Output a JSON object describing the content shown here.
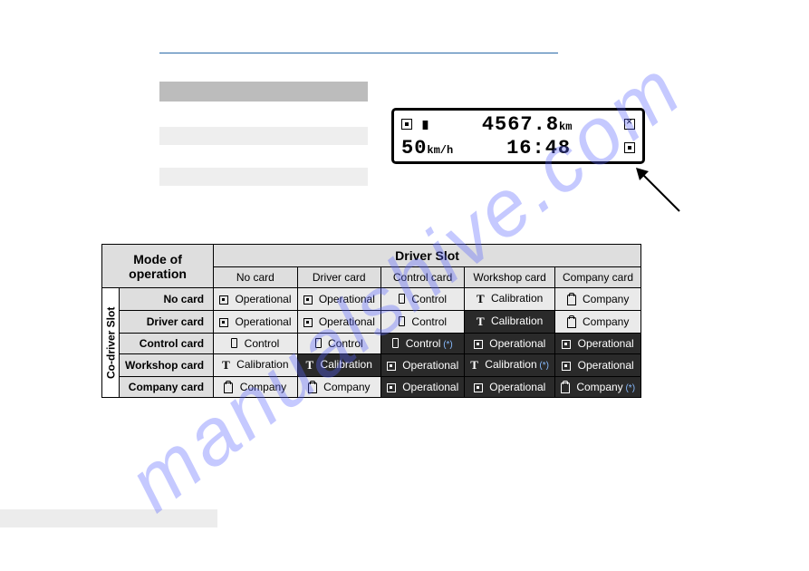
{
  "lcd": {
    "distance_value": "4567.8",
    "distance_unit": "km",
    "speed_value": "50",
    "speed_unit": "km/h",
    "time": "16:48"
  },
  "table": {
    "corner_line1": "Mode of",
    "corner_line2": "operation",
    "side_label": "Co-driver Slot",
    "top_label": "Driver Slot",
    "cols": [
      "No card",
      "Driver card",
      "Control card",
      "Workshop card",
      "Company card"
    ],
    "rows": [
      "No card",
      "Driver card",
      "Control card",
      "Workshop card",
      "Company card"
    ],
    "cells": [
      [
        {
          "icon": "dot",
          "text": "Operational",
          "dark": false
        },
        {
          "icon": "dot",
          "text": "Operational",
          "dark": false
        },
        {
          "icon": "phone",
          "text": "Control",
          "dark": false
        },
        {
          "icon": "t",
          "text": "Calibration",
          "dark": false
        },
        {
          "icon": "clip",
          "text": "Company",
          "dark": false
        }
      ],
      [
        {
          "icon": "dot",
          "text": "Operational",
          "dark": false
        },
        {
          "icon": "dot",
          "text": "Operational",
          "dark": false
        },
        {
          "icon": "phone",
          "text": "Control",
          "dark": false
        },
        {
          "icon": "t",
          "text": "Calibration",
          "dark": true
        },
        {
          "icon": "clip",
          "text": "Company",
          "dark": false
        }
      ],
      [
        {
          "icon": "phone",
          "text": "Control",
          "dark": false
        },
        {
          "icon": "phone",
          "text": "Control",
          "dark": false
        },
        {
          "icon": "phone",
          "text": "Control",
          "dark": true,
          "star": true
        },
        {
          "icon": "dot",
          "text": "Operational",
          "dark": true
        },
        {
          "icon": "dot",
          "text": "Operational",
          "dark": true
        }
      ],
      [
        {
          "icon": "t",
          "text": "Calibration",
          "dark": false
        },
        {
          "icon": "t",
          "text": "Calibration",
          "dark": true
        },
        {
          "icon": "dot",
          "text": "Operational",
          "dark": true
        },
        {
          "icon": "t",
          "text": "Calibration",
          "dark": true,
          "star": true
        },
        {
          "icon": "dot",
          "text": "Operational",
          "dark": true
        }
      ],
      [
        {
          "icon": "clip",
          "text": "Company",
          "dark": false
        },
        {
          "icon": "clip",
          "text": "Company",
          "dark": false
        },
        {
          "icon": "dot",
          "text": "Operational",
          "dark": true
        },
        {
          "icon": "dot",
          "text": "Operational",
          "dark": true
        },
        {
          "icon": "clip",
          "text": "Company",
          "dark": true,
          "star": true
        }
      ]
    ]
  },
  "watermark": "manualshive.com",
  "star_marker": "(*)"
}
